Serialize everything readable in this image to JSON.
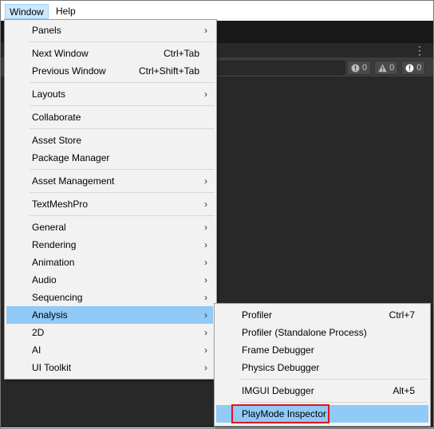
{
  "menubar": {
    "window_label": "Window",
    "help_label": "Help"
  },
  "console": {
    "counters": [
      {
        "icon": "info-icon",
        "count": "0"
      },
      {
        "icon": "warning-icon",
        "count": "0"
      },
      {
        "icon": "error-icon",
        "count": "0"
      }
    ]
  },
  "window_menu": {
    "panels": "Panels",
    "next_window": {
      "label": "Next Window",
      "shortcut": "Ctrl+Tab"
    },
    "previous_window": {
      "label": "Previous Window",
      "shortcut": "Ctrl+Shift+Tab"
    },
    "layouts": "Layouts",
    "collaborate": "Collaborate",
    "asset_store": "Asset Store",
    "package_manager": "Package Manager",
    "asset_management": "Asset Management",
    "textmeshpro": "TextMeshPro",
    "general": "General",
    "rendering": "Rendering",
    "animation": "Animation",
    "audio": "Audio",
    "sequencing": "Sequencing",
    "analysis": "Analysis",
    "twod": "2D",
    "ai": "AI",
    "ui_toolkit": "UI Toolkit",
    "arrow": "›"
  },
  "analysis_menu": {
    "profiler": {
      "label": "Profiler",
      "shortcut": "Ctrl+7"
    },
    "profiler_standalone": "Profiler (Standalone Process)",
    "frame_debugger": "Frame Debugger",
    "physics_debugger": "Physics Debugger",
    "imgui_debugger": {
      "label": "IMGUI Debugger",
      "shortcut": "Alt+5"
    },
    "playmode_inspector": "PlayMode Inspector"
  },
  "colors": {
    "highlight": "#91c9f7",
    "annotation_box": "#e3141c"
  }
}
